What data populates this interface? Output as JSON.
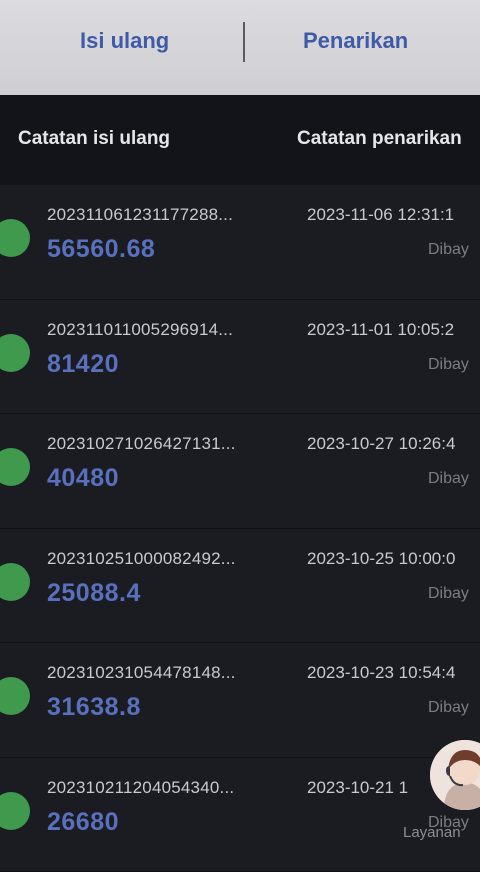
{
  "tabs": {
    "left": "Isi ulang",
    "right": "Penarikan"
  },
  "subheader": {
    "left": "Catatan isi ulang",
    "right": "Catatan penarikan"
  },
  "records": [
    {
      "id": "202311061231177288...",
      "amount": "56560.68",
      "date": "2023-11-06 12:31:1",
      "status": "Dibay"
    },
    {
      "id": "202311011005296914...",
      "amount": "81420",
      "date": "2023-11-01 10:05:2",
      "status": "Dibay"
    },
    {
      "id": "202310271026427131...",
      "amount": "40480",
      "date": "2023-10-27 10:26:4",
      "status": "Dibay"
    },
    {
      "id": "202310251000082492...",
      "amount": "25088.4",
      "date": "2023-10-25 10:00:0",
      "status": "Dibay"
    },
    {
      "id": "202310231054478148...",
      "amount": "31638.8",
      "date": "2023-10-23 10:54:4",
      "status": "Dibay"
    },
    {
      "id": "202310211204054340...",
      "amount": "26680",
      "date": "2023-10-21 1",
      "status": "Dibay"
    }
  ],
  "support": {
    "label": "Layanan"
  },
  "colors": {
    "accent": "#3f5aa6",
    "amount": "#5870bd",
    "status_dot": "#3f9a4e",
    "background": "#15161b"
  },
  "icons": {
    "status": "green-dot-icon",
    "support": "customer-service-avatar-icon"
  }
}
